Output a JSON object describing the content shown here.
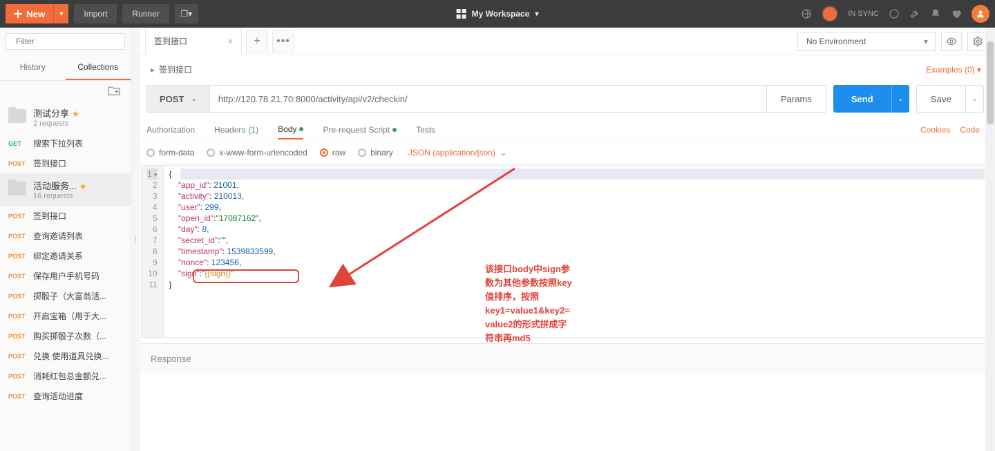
{
  "topbar": {
    "new": "New",
    "import": "Import",
    "runner": "Runner",
    "workspace": "My Workspace",
    "sync": "IN SYNC"
  },
  "sidebar": {
    "filter_placeholder": "Filter",
    "tab_history": "History",
    "tab_collections": "Collections",
    "collections": [
      {
        "name": "测试分享",
        "meta": "2 requests",
        "starred": true
      },
      {
        "name": "活动服务...",
        "meta": "16 requests",
        "starred": true
      }
    ],
    "requests_group1": [
      {
        "method": "GET",
        "name": "搜索下拉列表"
      },
      {
        "method": "POST",
        "name": "签到接口"
      }
    ],
    "requests_group2": [
      {
        "method": "POST",
        "name": "签到接口"
      },
      {
        "method": "POST",
        "name": "查询邀请列表"
      },
      {
        "method": "POST",
        "name": "绑定邀请关系"
      },
      {
        "method": "POST",
        "name": "保存用户手机号码"
      },
      {
        "method": "POST",
        "name": "掷骰子（大富翁活..."
      },
      {
        "method": "POST",
        "name": "开启宝箱（用于大..."
      },
      {
        "method": "POST",
        "name": "购买掷骰子次数（..."
      },
      {
        "method": "POST",
        "name": "兑换 使用道具兑换..."
      },
      {
        "method": "POST",
        "name": "消耗红包总金额兑..."
      },
      {
        "method": "POST",
        "name": "查询活动进度"
      }
    ]
  },
  "tab": {
    "title": "签到接口"
  },
  "env": {
    "selected": "No Environment"
  },
  "breadcrumb": {
    "title": "签到接口",
    "examples": "Examples (0)"
  },
  "request": {
    "method": "POST",
    "url": "http://120.78.21.70:8000/activity/api/v2/checkin/",
    "params": "Params",
    "send": "Send",
    "save": "Save"
  },
  "reqtabs": {
    "auth": "Authorization",
    "headers": "Headers",
    "headers_count": "(1)",
    "body": "Body",
    "prereq": "Pre-request Script",
    "tests": "Tests",
    "cookies": "Cookies",
    "code": "Code"
  },
  "bodytypes": {
    "formdata": "form-data",
    "urlencoded": "x-www-form-urlencoded",
    "raw": "raw",
    "binary": "binary",
    "contenttype": "JSON (application/json)"
  },
  "code_lines": [
    "{",
    "    \"app_id\": 21001,",
    "    \"activity\": 210013,",
    "    \"user\": 299,",
    "    \"open_id\":\"17087162\",",
    "    \"day\": 8,",
    "    \"secret_id\":\"\",",
    "    \"timestamp\":1539833599,",
    "    \"nonce\":123456,",
    "    \"sign\":\"{{sign}}\"",
    "}"
  ],
  "annotation": "该接口body中sign参\n数为其他参数按照key\n值排序，按照\nkey1=value1&key2=\nvalue2的形式拼成字\n符串再md5",
  "response": {
    "label": "Response"
  }
}
